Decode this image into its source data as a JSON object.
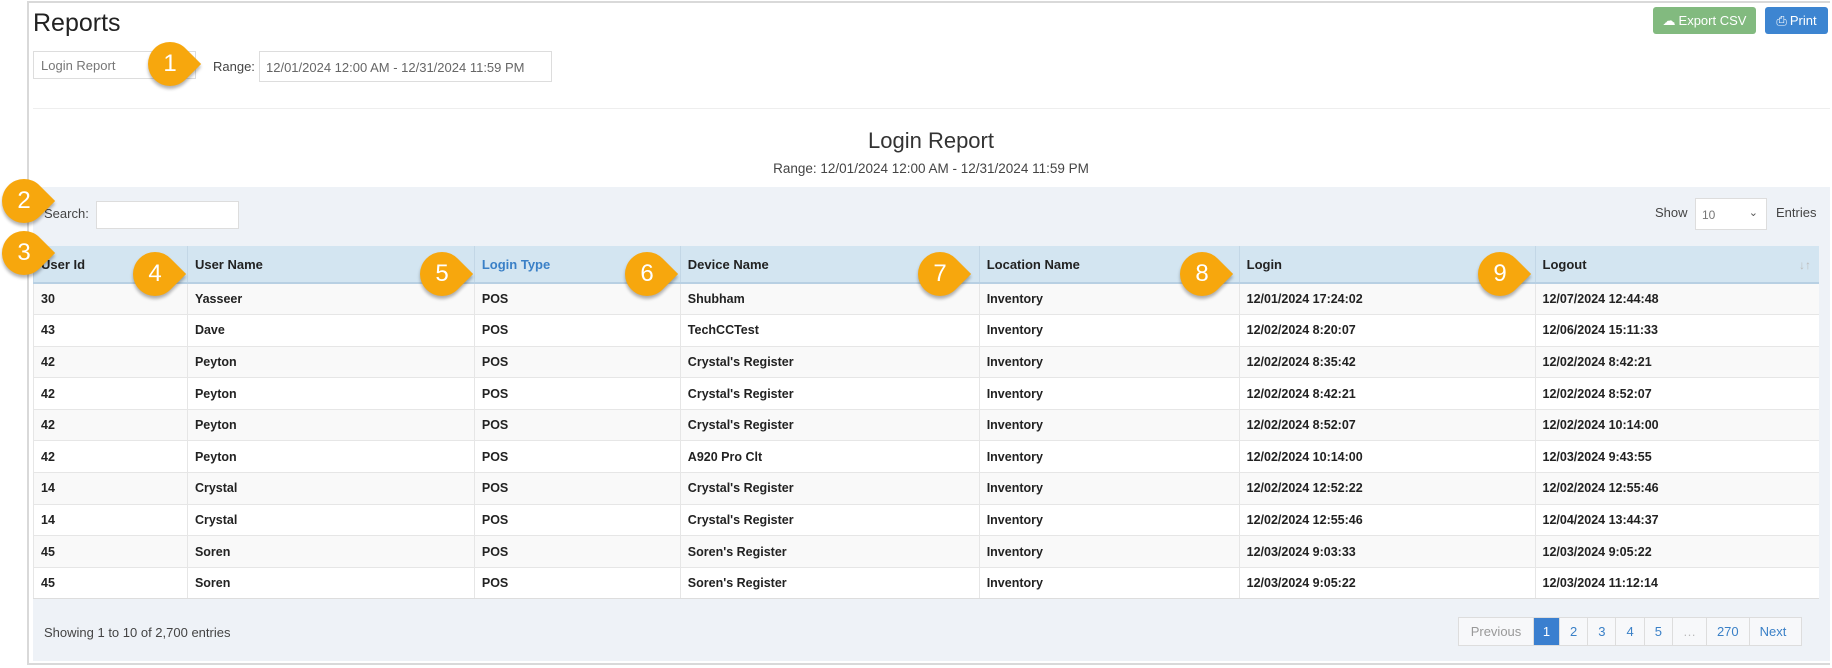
{
  "header": {
    "title": "Reports",
    "report_select": "Login Report",
    "range_label": "Range:",
    "range_value": "12/01/2024 12:00 AM - 12/31/2024 11:59 PM",
    "export_label": "Export CSV",
    "print_label": "Print"
  },
  "report": {
    "title": "Login Report",
    "subtitle": "Range: 12/01/2024 12:00 AM - 12/31/2024 11:59 PM"
  },
  "controls": {
    "search_label": "Search:",
    "search_value": "",
    "show_label": "Show",
    "show_value": "10",
    "entries_label": "Entries"
  },
  "table": {
    "columns": [
      "User Id",
      "User Name",
      "Login Type",
      "Device Name",
      "Location Name",
      "Login",
      "Logout"
    ],
    "rows": [
      [
        "30",
        "Yasseer",
        "POS",
        "Shubham",
        "Inventory",
        "12/01/2024 17:24:02",
        "12/07/2024 12:44:48"
      ],
      [
        "43",
        "Dave",
        "POS",
        "TechCCTest",
        "Inventory",
        "12/02/2024 8:20:07",
        "12/06/2024 15:11:33"
      ],
      [
        "42",
        "Peyton",
        "POS",
        "Crystal's Register",
        "Inventory",
        "12/02/2024 8:35:42",
        "12/02/2024 8:42:21"
      ],
      [
        "42",
        "Peyton",
        "POS",
        "Crystal's Register",
        "Inventory",
        "12/02/2024 8:42:21",
        "12/02/2024 8:52:07"
      ],
      [
        "42",
        "Peyton",
        "POS",
        "Crystal's Register",
        "Inventory",
        "12/02/2024 8:52:07",
        "12/02/2024 10:14:00"
      ],
      [
        "42",
        "Peyton",
        "POS",
        "A920 Pro Clt",
        "Inventory",
        "12/02/2024 10:14:00",
        "12/03/2024 9:43:55"
      ],
      [
        "14",
        "Crystal",
        "POS",
        "Crystal's Register",
        "Inventory",
        "12/02/2024 12:52:22",
        "12/02/2024 12:55:46"
      ],
      [
        "14",
        "Crystal",
        "POS",
        "Crystal's Register",
        "Inventory",
        "12/02/2024 12:55:46",
        "12/04/2024 13:44:37"
      ],
      [
        "45",
        "Soren",
        "POS",
        "Soren's Register",
        "Inventory",
        "12/03/2024 9:03:33",
        "12/03/2024 9:05:22"
      ],
      [
        "45",
        "Soren",
        "POS",
        "Soren's Register",
        "Inventory",
        "12/03/2024 9:05:22",
        "12/03/2024 11:12:14"
      ]
    ]
  },
  "footer": {
    "showing": "Showing 1 to 10 of 2,700 entries",
    "pages": [
      "Previous",
      "1",
      "2",
      "3",
      "4",
      "5",
      "…",
      "270",
      "Next"
    ],
    "active_page": "1"
  },
  "callouts": [
    "1",
    "2",
    "3",
    "4",
    "5",
    "6",
    "7",
    "8",
    "9"
  ],
  "colors": {
    "accent": "#3a7fcf",
    "export": "#82ba7f",
    "callout": "#f7a70d",
    "header_bg": "#d3e5f1"
  }
}
